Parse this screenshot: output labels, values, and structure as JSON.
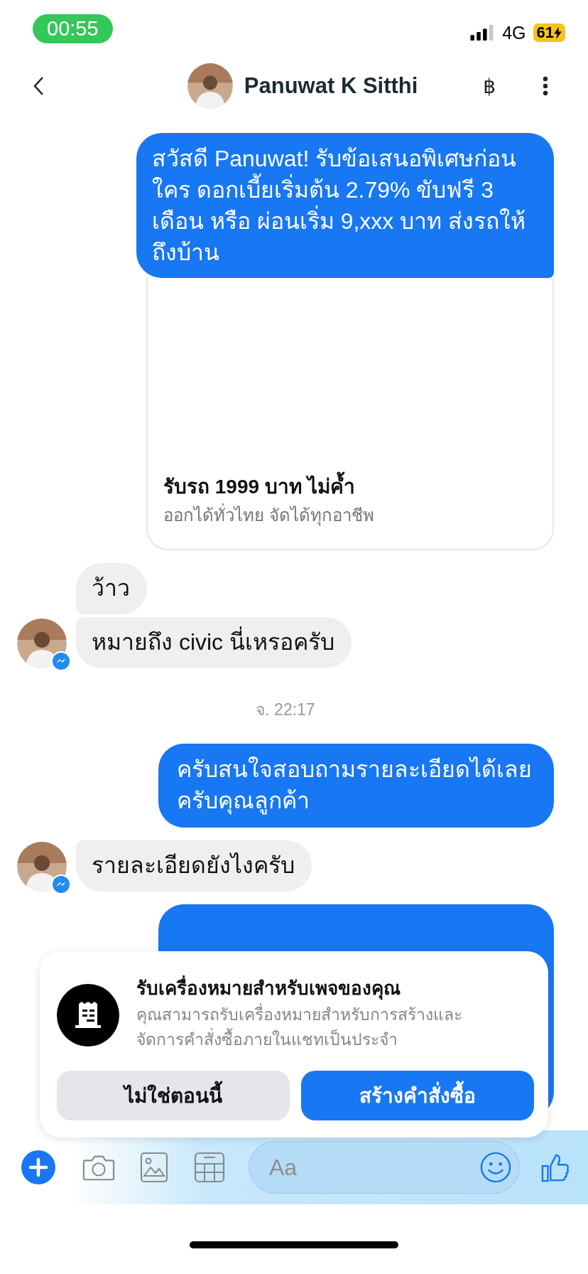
{
  "status_bar": {
    "time": "00:55",
    "network": "4G",
    "battery": "61"
  },
  "header": {
    "contact_name": "Panuwat K Sitthi",
    "currency_symbol": "฿"
  },
  "messages": [
    {
      "kind": "outgoing",
      "text": "สวัสดี Panuwat! รับข้อเสนอพิเศษก่อนใคร ดอกเบี้ยเริ่มต้น 2.79%  ขับฟรี 3 เดือน หรือ ผ่อนเริ่ม 9,xxx บาท ส่งรถให้ถึงบ้าน",
      "joined": true
    },
    {
      "kind": "card",
      "title": "รับรถ 1999 บาท ไม่ค้ำ",
      "subtitle": "ออกได้ทั่วไทย จัดได้ทุกอาชีพ"
    },
    {
      "kind": "incoming",
      "text": "ว้าว",
      "avatar": false
    },
    {
      "kind": "incoming",
      "text": "หมายถึง civic นี่เหรอครับ",
      "avatar": true
    },
    {
      "kind": "timestamp",
      "text": "จ. 22:17"
    },
    {
      "kind": "outgoing",
      "text": "ครับสนใจสอบถามรายละเอียดได้เลยครับคุณลูกค้า",
      "joined": false
    },
    {
      "kind": "incoming",
      "text": "รายละเอียดยังไงครับ",
      "avatar": true
    },
    {
      "kind": "hidden_outgoing"
    }
  ],
  "popup": {
    "title": "รับเครื่องหมายสำหรับเพจของคุณ",
    "body": "คุณสามารถรับเครื่องหมายสำหรับการสร้างและจัดการคำสั่งซื้อภายในแชทเป็นประจำ",
    "buttons": [
      {
        "label": "ไม่ใช่ตอนนี้",
        "kind": "secondary"
      },
      {
        "label": "สร้างคำสั่งซื้อ",
        "kind": "primary"
      }
    ]
  },
  "composer": {
    "placeholder": "Aa"
  }
}
